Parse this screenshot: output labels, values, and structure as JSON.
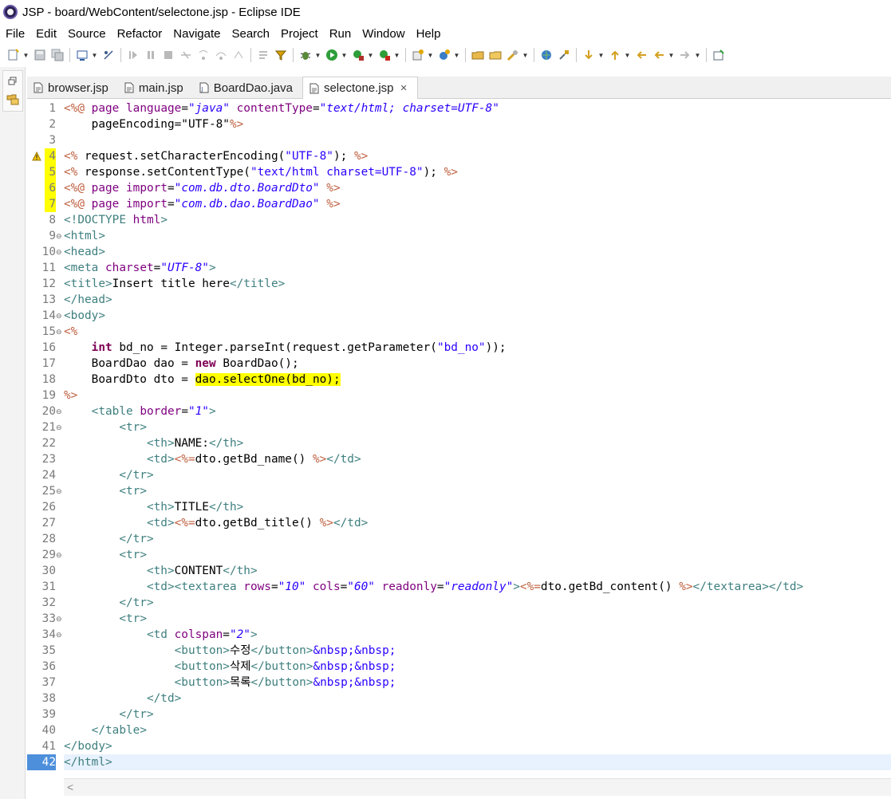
{
  "window": {
    "title": "JSP - board/WebContent/selectone.jsp - Eclipse IDE"
  },
  "menubar": [
    "File",
    "Edit",
    "Source",
    "Refactor",
    "Navigate",
    "Search",
    "Project",
    "Run",
    "Window",
    "Help"
  ],
  "tabs": [
    {
      "label": "browser.jsp",
      "active": false
    },
    {
      "label": "main.jsp",
      "active": false
    },
    {
      "label": "BoardDao.java",
      "active": false
    },
    {
      "label": "selectone.jsp",
      "active": true
    }
  ],
  "editor": {
    "highlighted_lines": [
      4,
      5,
      6,
      7
    ],
    "warning_line": 4,
    "current_line": 42,
    "fold_lines": [
      9,
      10,
      14,
      15,
      20,
      21,
      25,
      29,
      33,
      34
    ],
    "lines": [
      "<%@ page language=\"java\" contentType=\"text/html; charset=UTF-8\"",
      "    pageEncoding=\"UTF-8\"%>",
      "",
      "<% request.setCharacterEncoding(\"UTF-8\"); %>",
      "<% response.setContentType(\"text/html charset=UTF-8\"); %>",
      "<%@ page import=\"com.db.dto.BoardDto\" %>",
      "<%@ page import=\"com.db.dao.BoardDao\" %>",
      "<!DOCTYPE html>",
      "<html>",
      "<head>",
      "<meta charset=\"UTF-8\">",
      "<title>Insert title here</title>",
      "</head>",
      "<body>",
      "<%",
      "    int bd_no = Integer.parseInt(request.getParameter(\"bd_no\"));",
      "    BoardDao dao = new BoardDao();",
      "    BoardDto dto = dao.selectOne(bd_no);",
      "%>",
      "    <table border=\"1\">",
      "        <tr>",
      "            <th>NAME:</th>",
      "            <td><%=dto.getBd_name() %></td>",
      "        </tr>",
      "        <tr>",
      "            <th>TITLE</th>",
      "            <td><%=dto.getBd_title() %></td>",
      "        </tr>",
      "        <tr>",
      "            <th>CONTENT</th>",
      "            <td><textarea rows=\"10\" cols=\"60\" readonly=\"readonly\"><%=dto.getBd_content() %></textarea></td>",
      "        </tr>",
      "        <tr>",
      "            <td colspan=\"2\">",
      "                <button>수정</button>&nbsp;&nbsp;",
      "                <button>삭제</button>&nbsp;&nbsp;",
      "                <button>목록</button>&nbsp;&nbsp;",
      "            </td>",
      "        </tr>",
      "    </table>",
      "</body>",
      "</html>"
    ]
  },
  "colors": {
    "keyword": "#7f0055",
    "tag": "#3f7f7f",
    "attribute": "#7f007f",
    "attribute_value": "#2a00ff",
    "jsp_delimiter": "#bf5f3f",
    "highlight": "#ffff00",
    "current_line_number": "#4d8fdb"
  }
}
